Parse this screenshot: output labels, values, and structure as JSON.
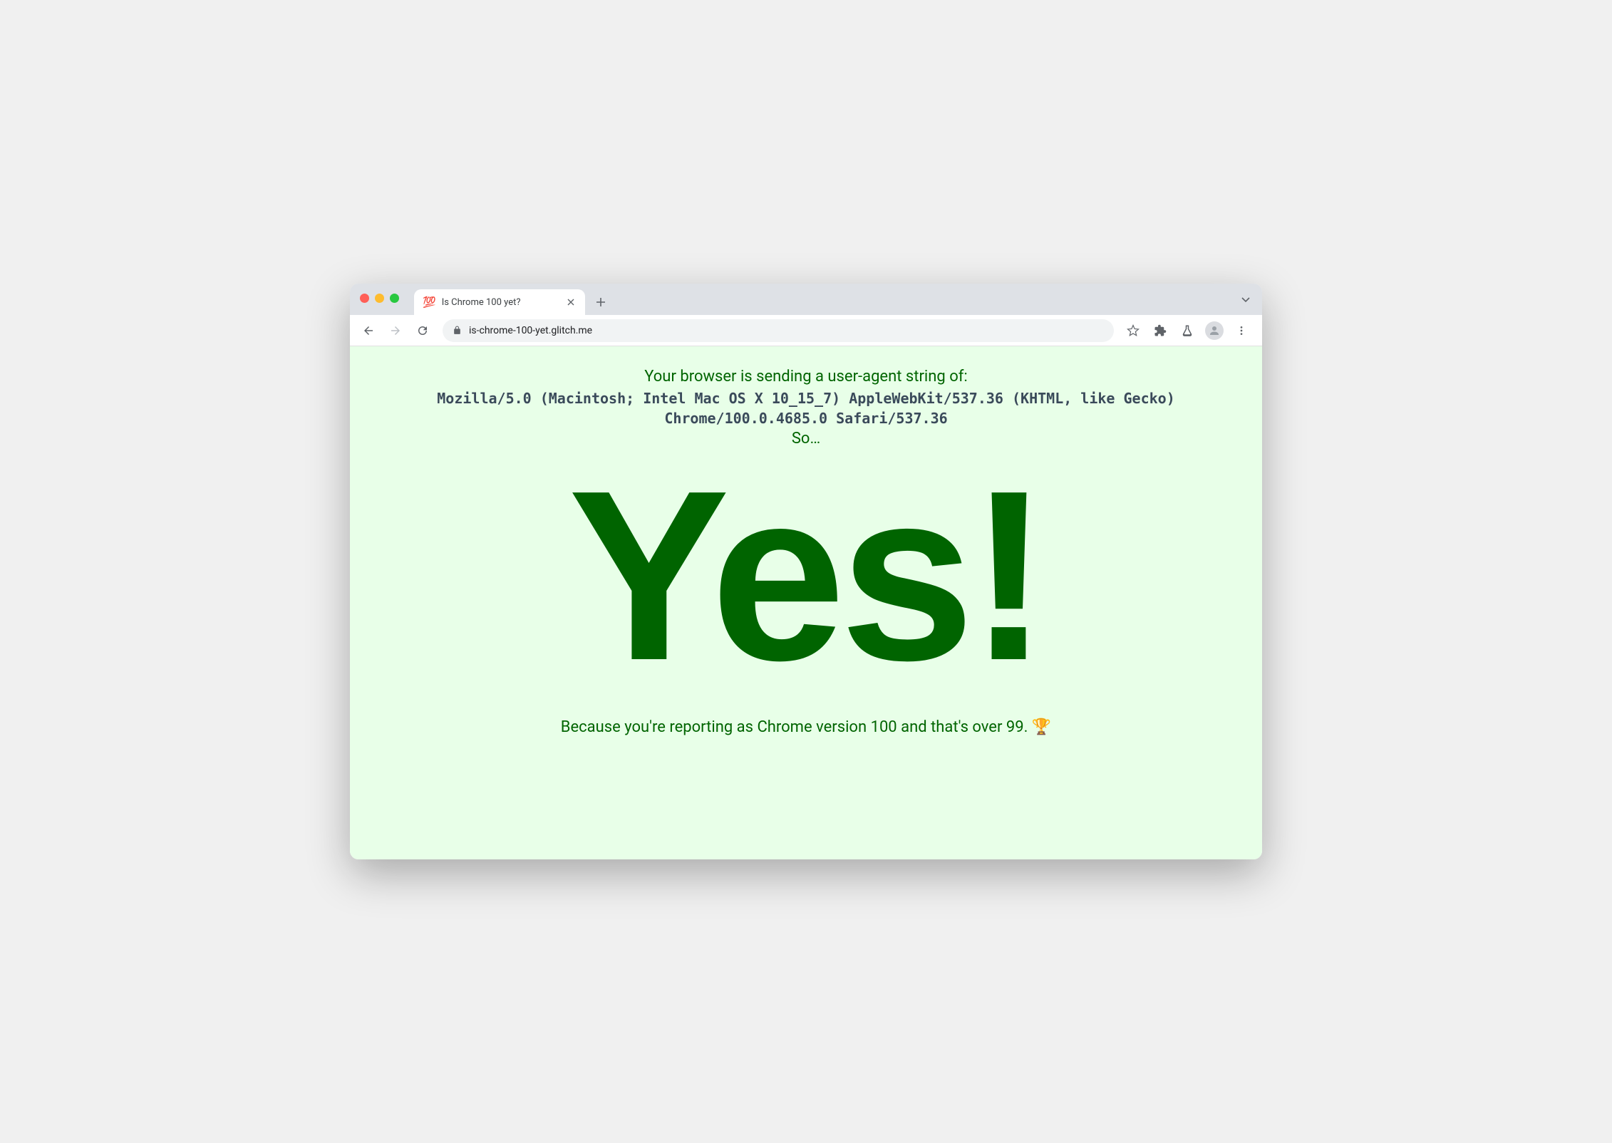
{
  "tab": {
    "favicon": "💯",
    "title": "Is Chrome 100 yet?"
  },
  "url": "is-chrome-100-yet.glitch.me",
  "page": {
    "intro": "Your browser is sending a user-agent string of:",
    "ua": "Mozilla/5.0 (Macintosh; Intel Mac OS X 10_15_7) AppleWebKit/537.36 (KHTML, like Gecko)\nChrome/100.0.4685.0 Safari/537.36",
    "so": "So…",
    "big": "Yes!",
    "because": "Because you're reporting as Chrome version 100 and that's over 99. 🏆"
  }
}
